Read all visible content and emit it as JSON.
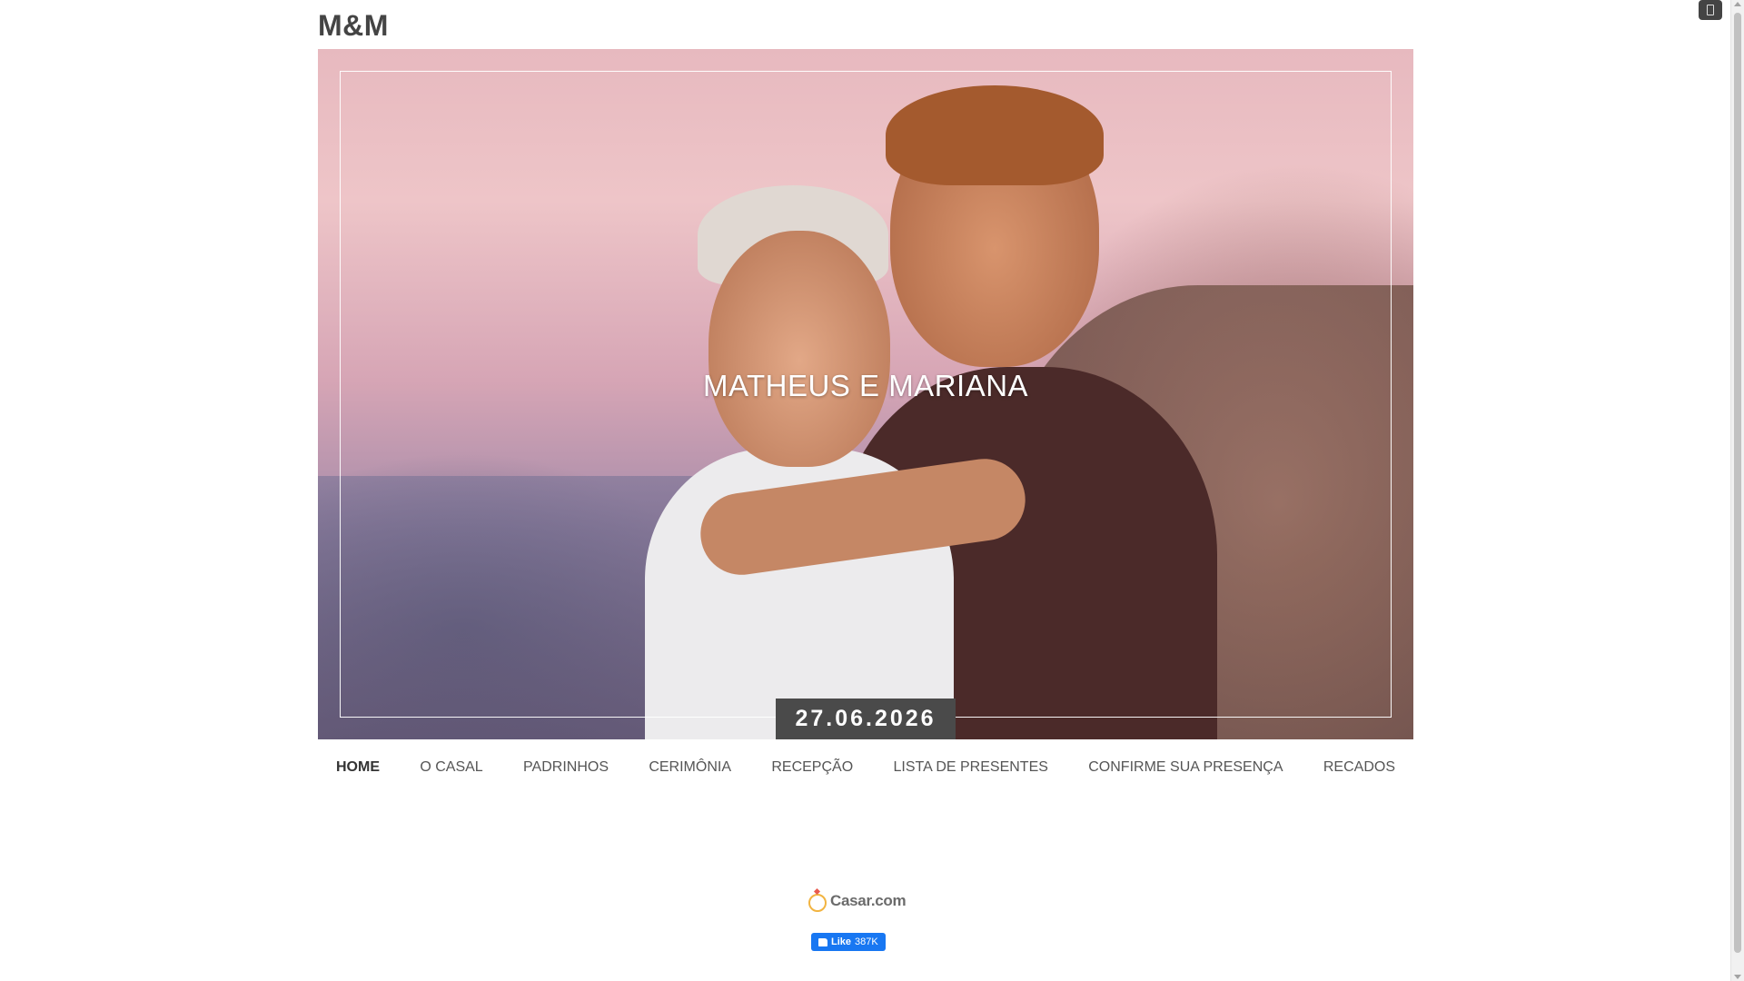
{
  "brand": "M&M",
  "hero": {
    "couple_name": "MATHEUS E MARIANA",
    "date": "27.06.2026",
    "photo_description_icon": "couple-photo"
  },
  "nav": {
    "items": [
      {
        "label": "HOME",
        "active": true
      },
      {
        "label": "O CASAL"
      },
      {
        "label": "PADRINHOS"
      },
      {
        "label": "CERIMÔNIA"
      },
      {
        "label": "RECEPÇÃO"
      },
      {
        "label": "LISTA DE PRESENTES"
      },
      {
        "label": "CONFIRME SUA PRESENÇA"
      },
      {
        "label": "RECADOS"
      }
    ]
  },
  "footer": {
    "logo_text": "Casar.com",
    "like_label": "Like",
    "like_count": "387K"
  },
  "colors": {
    "date_badge_bg": "#4a4a4a",
    "facebook_blue": "#1877f2",
    "ring_gold": "#f2b441"
  }
}
